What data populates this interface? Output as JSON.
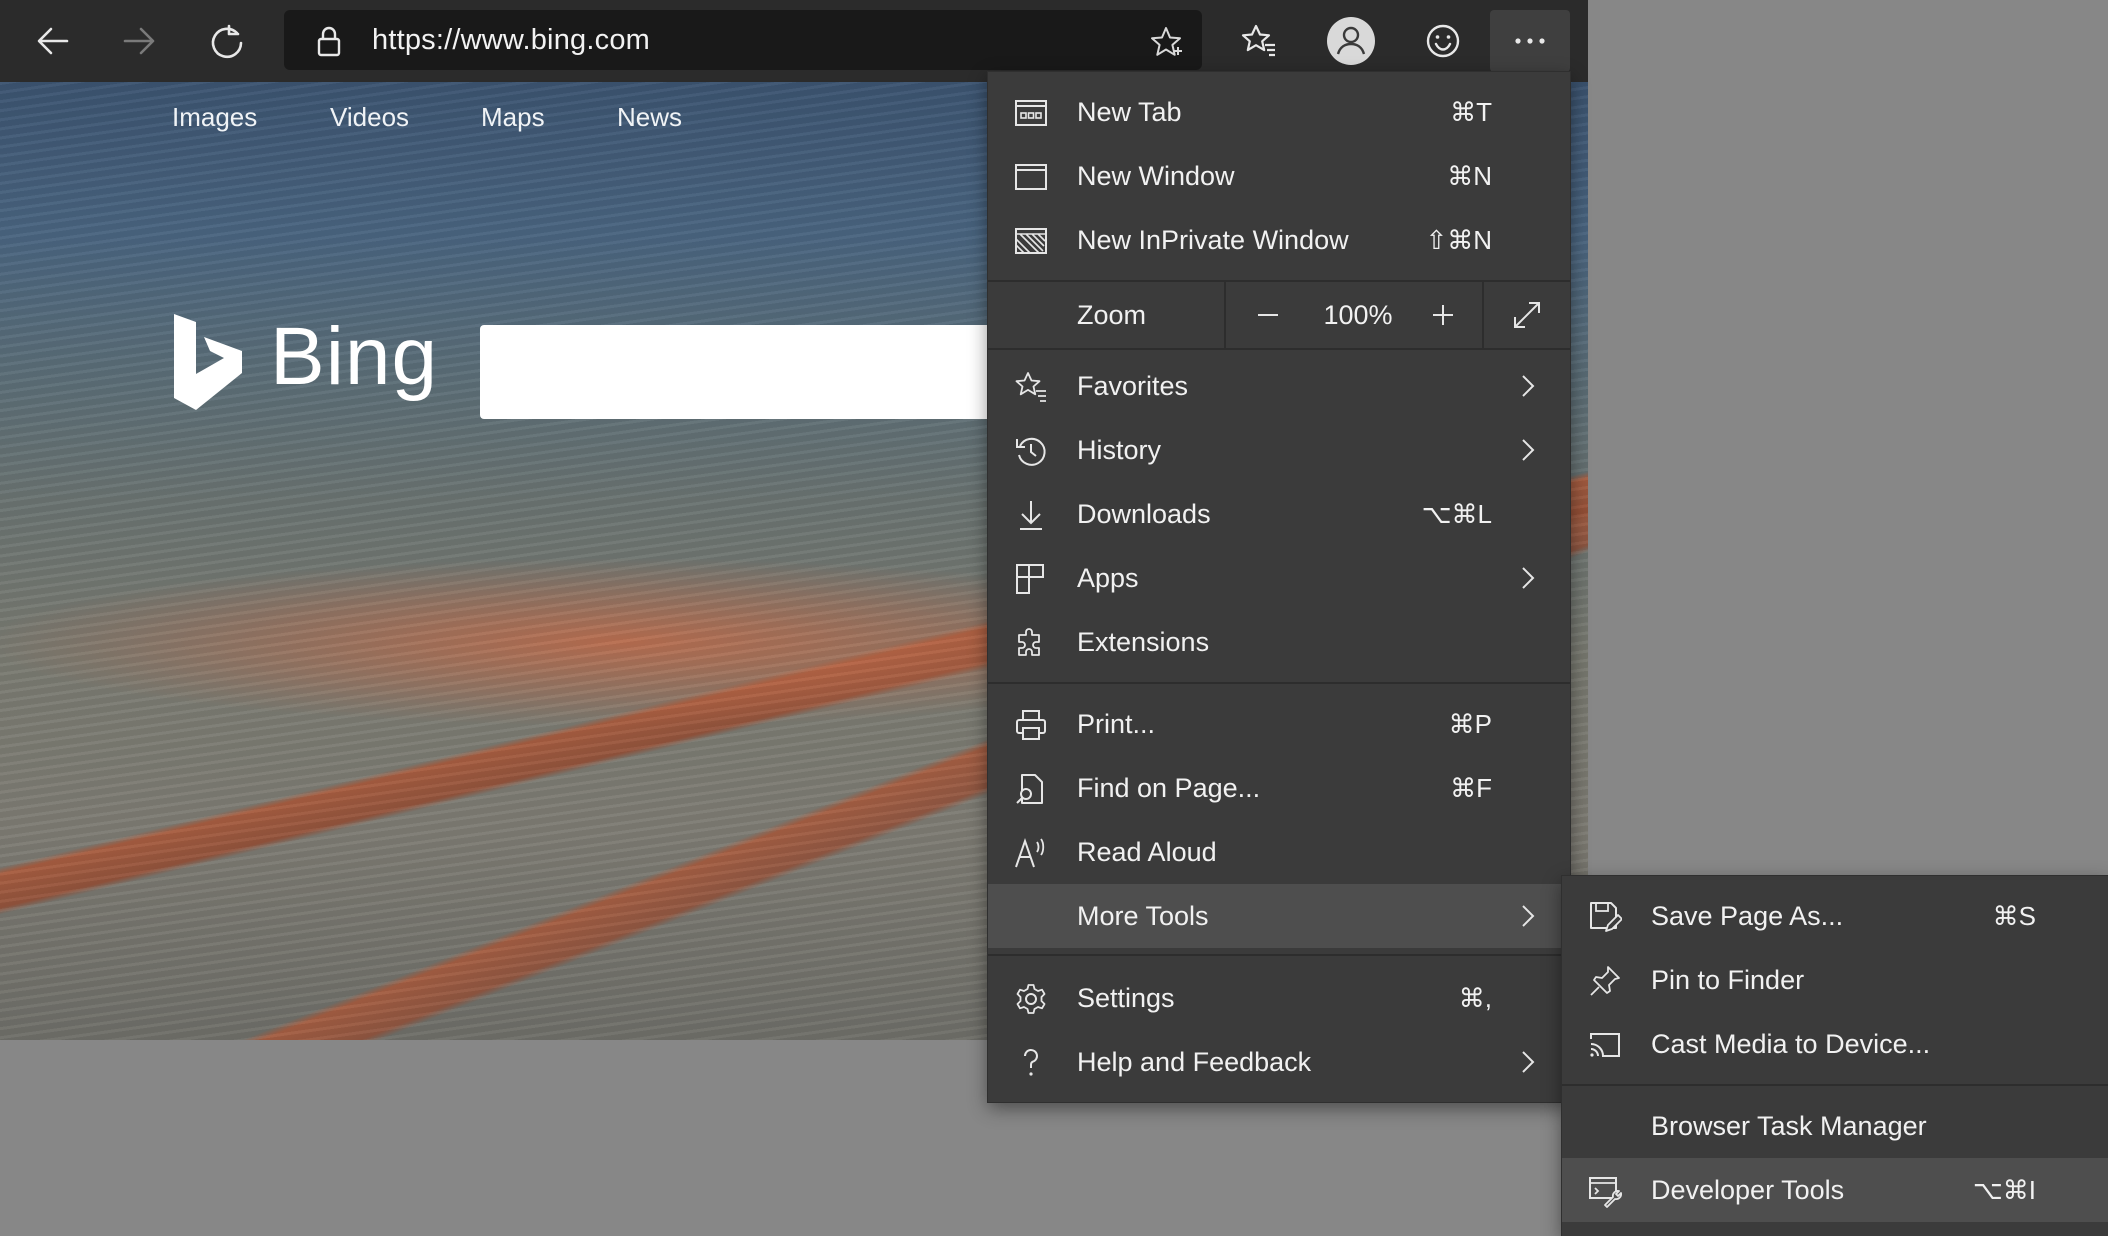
{
  "browser": {
    "url": "https://www.bing.com",
    "icons": [
      "back-icon",
      "forward-icon",
      "refresh-icon",
      "lock-icon",
      "add-favorite-icon",
      "favorites-icon",
      "profile-icon",
      "feedback-icon",
      "more-icon"
    ]
  },
  "page": {
    "nav": [
      "Images",
      "Videos",
      "Maps",
      "News"
    ],
    "brand": "Bing",
    "search_value": ""
  },
  "menu": {
    "items": [
      {
        "label": "New Tab",
        "shortcut": "⌘T",
        "icon": "new-tab-icon"
      },
      {
        "label": "New Window",
        "shortcut": "⌘N",
        "icon": "new-window-icon"
      },
      {
        "label": "New InPrivate Window",
        "shortcut": "⇧⌘N",
        "icon": "inprivate-icon"
      },
      {
        "label": "Favorites",
        "shortcut": "",
        "icon": "favorites-icon",
        "submenu": true
      },
      {
        "label": "History",
        "shortcut": "",
        "icon": "history-icon",
        "submenu": true
      },
      {
        "label": "Downloads",
        "shortcut": "⌥⌘L",
        "icon": "download-icon"
      },
      {
        "label": "Apps",
        "shortcut": "",
        "icon": "apps-icon",
        "submenu": true
      },
      {
        "label": "Extensions",
        "shortcut": "",
        "icon": "extensions-icon"
      },
      {
        "label": "Print...",
        "shortcut": "⌘P",
        "icon": "print-icon"
      },
      {
        "label": "Find on Page...",
        "shortcut": "⌘F",
        "icon": "find-icon"
      },
      {
        "label": "Read Aloud",
        "shortcut": "",
        "icon": "read-aloud-icon"
      },
      {
        "label": "More Tools",
        "shortcut": "",
        "icon": "",
        "submenu": true,
        "highlighted": true
      },
      {
        "label": "Settings",
        "shortcut": "⌘,",
        "icon": "settings-icon"
      },
      {
        "label": "Help and Feedback",
        "shortcut": "",
        "icon": "help-icon",
        "submenu": true
      }
    ],
    "zoom": {
      "label": "Zoom",
      "value": "100%",
      "minus": "−",
      "plus": "+"
    }
  },
  "submenu": {
    "items": [
      {
        "label": "Save Page As...",
        "shortcut": "⌘S",
        "icon": "save-page-icon"
      },
      {
        "label": "Pin to Finder",
        "shortcut": "",
        "icon": "pin-icon"
      },
      {
        "label": "Cast Media to Device...",
        "shortcut": "",
        "icon": "cast-icon"
      },
      {
        "label": "Browser Task Manager",
        "shortcut": "",
        "icon": ""
      },
      {
        "label": "Developer Tools",
        "shortcut": "⌥⌘I",
        "icon": "developer-tools-icon",
        "highlighted": true
      }
    ]
  },
  "colors": {
    "menu_bg": "#3b3b3b",
    "menu_highlight": "#4e4e4e",
    "toolbar_bg": "#2b2b2b",
    "desktop_bg": "#878787"
  }
}
